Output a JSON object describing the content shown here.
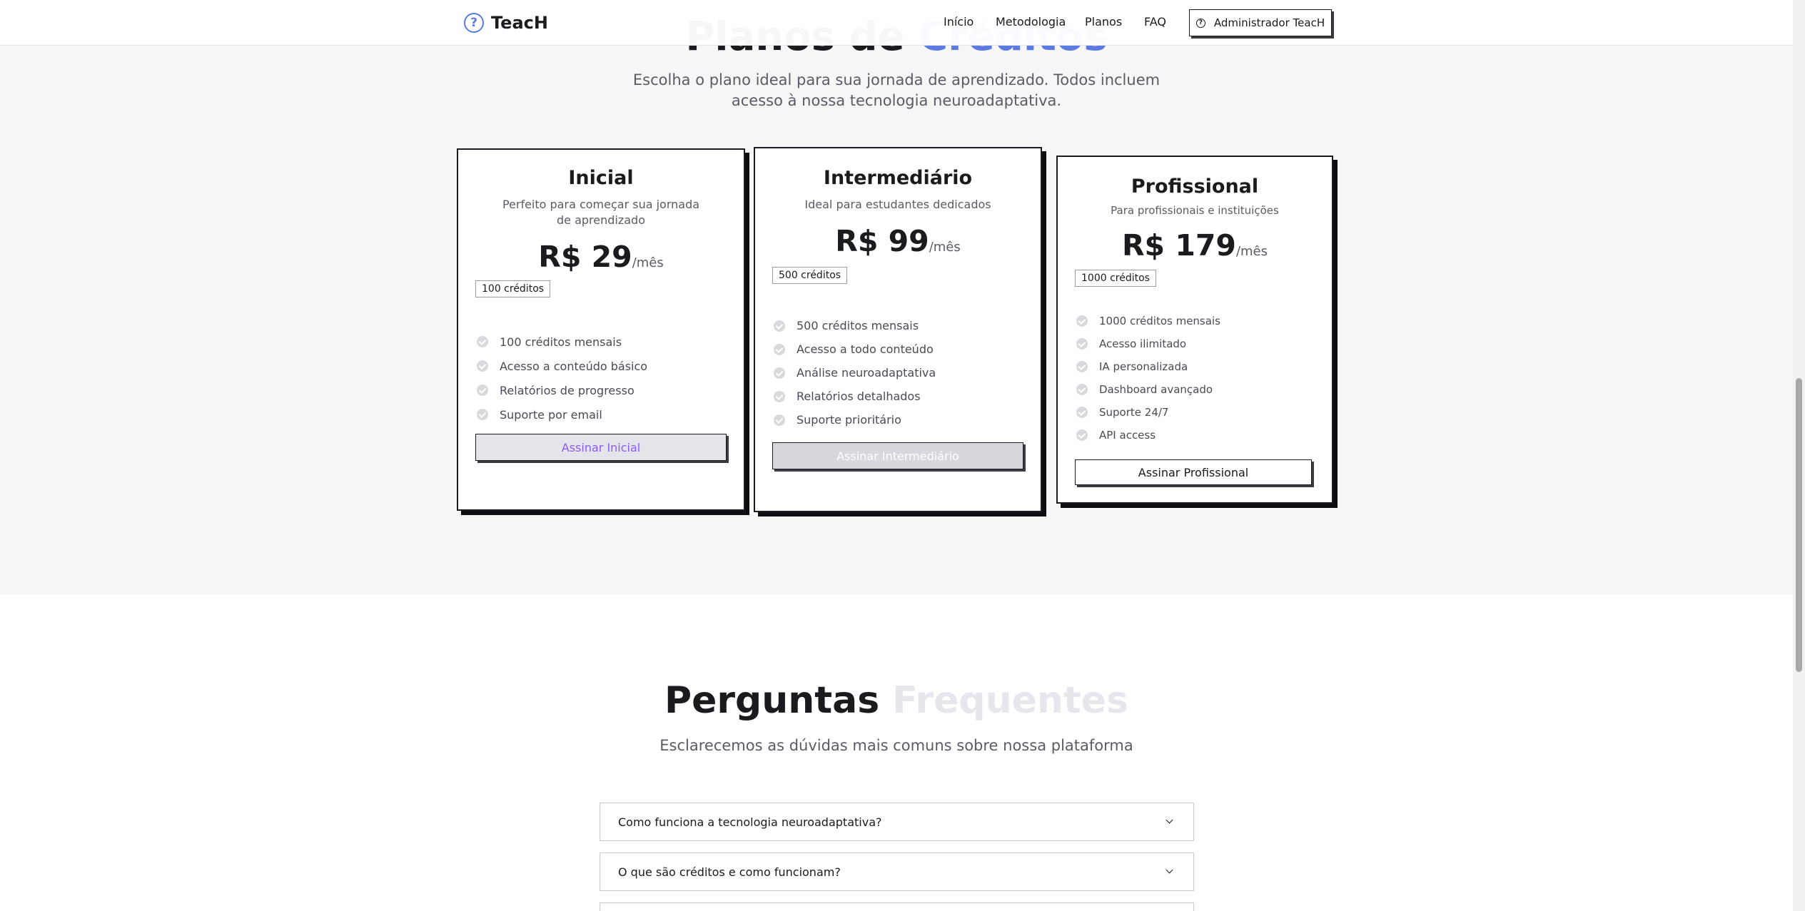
{
  "header": {
    "logo_text": "TeacH",
    "logo_icon_glyph": "?",
    "nav": [
      "Início",
      "Metodologia",
      "Planos",
      "FAQ"
    ],
    "admin_label": "Administrador TeacH"
  },
  "pricing": {
    "title_visible": "Planos de",
    "title_accent": "Créditos",
    "subtitle": "Escolha o plano ideal para sua jornada de aprendizado. Todos incluem acesso à nossa tecnologia neuroadaptativa.",
    "plans": [
      {
        "name": "Inicial",
        "description": "Perfeito para começar sua jornada de aprendizado",
        "price": "R$ 29",
        "period": "/mês",
        "credits_badge": "100 créditos",
        "features": [
          "100 créditos mensais",
          "Acesso a conteúdo básico",
          "Relatórios de progresso",
          "Suporte por email"
        ],
        "button_label": "Assinar Inicial"
      },
      {
        "name": "Intermediário",
        "description": "Ideal para estudantes dedicados",
        "price": "R$ 99",
        "period": "/mês",
        "credits_badge": "500 créditos",
        "features": [
          "500 créditos mensais",
          "Acesso a todo conteúdo",
          "Análise neuroadaptativa",
          "Relatórios detalhados",
          "Suporte prioritário"
        ],
        "button_label": "Assinar Intermediário"
      },
      {
        "name": "Profissional",
        "description": "Para profissionais e instituições",
        "price": "R$ 179",
        "period": "/mês",
        "credits_badge": "1000 créditos",
        "features": [
          "1000 créditos mensais",
          "Acesso ilimitado",
          "IA personalizada",
          "Dashboard avançado",
          "Suporte 24/7",
          "API access"
        ],
        "button_label": "Assinar Profissional"
      }
    ]
  },
  "faq": {
    "title_main": "Perguntas",
    "title_faint": "Frequentes",
    "subtitle": "Esclarecemos as dúvidas mais comuns sobre nossa plataforma",
    "questions": [
      "Como funciona a tecnologia neuroadaptativa?",
      "O que são créditos e como funcionam?"
    ]
  },
  "colors": {
    "accent": "#5b7be0",
    "button_primary_text": "#8a5cf0",
    "section_bg": "#f6f6f7"
  }
}
